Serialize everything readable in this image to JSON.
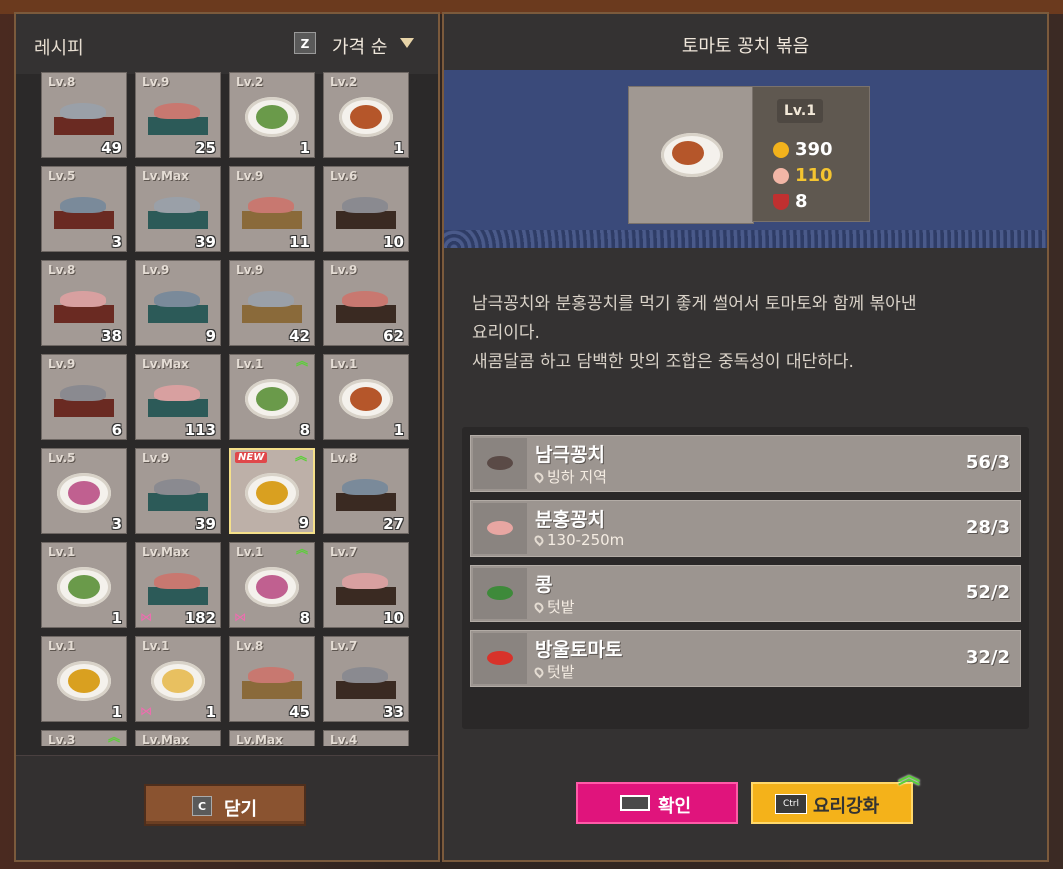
{
  "recipes_panel": {
    "title": "레시피",
    "sort_key": "Z",
    "sort_label": "가격 순",
    "close_key": "C",
    "close_label": "닫기",
    "cards": [
      {
        "lv": "Lv.8",
        "count": "49",
        "dish": "board"
      },
      {
        "lv": "Lv.9",
        "count": "25",
        "dish": "board"
      },
      {
        "lv": "Lv.2",
        "count": "1",
        "dish": "plate"
      },
      {
        "lv": "Lv.2",
        "count": "1",
        "dish": "plate"
      },
      {
        "lv": "Lv.5",
        "count": "3",
        "dish": "board"
      },
      {
        "lv": "Lv.Max",
        "count": "39",
        "dish": "board"
      },
      {
        "lv": "Lv.9",
        "count": "11",
        "dish": "board"
      },
      {
        "lv": "Lv.6",
        "count": "10",
        "dish": "board"
      },
      {
        "lv": "Lv.8",
        "count": "38",
        "dish": "board"
      },
      {
        "lv": "Lv.9",
        "count": "9",
        "dish": "board"
      },
      {
        "lv": "Lv.9",
        "count": "42",
        "dish": "board"
      },
      {
        "lv": "Lv.9",
        "count": "62",
        "dish": "board"
      },
      {
        "lv": "Lv.9",
        "count": "6",
        "dish": "board"
      },
      {
        "lv": "Lv.Max",
        "count": "113",
        "dish": "board"
      },
      {
        "lv": "Lv.1",
        "count": "8",
        "dish": "plate",
        "up": true
      },
      {
        "lv": "Lv.1",
        "count": "1",
        "dish": "plate"
      },
      {
        "lv": "Lv.5",
        "count": "3",
        "dish": "plate"
      },
      {
        "lv": "Lv.9",
        "count": "39",
        "dish": "board"
      },
      {
        "lv": "NEW",
        "count": "9",
        "dish": "plate",
        "up": true,
        "selected": true,
        "is_new": true
      },
      {
        "lv": "Lv.8",
        "count": "27",
        "dish": "board"
      },
      {
        "lv": "Lv.1",
        "count": "1",
        "dish": "plate"
      },
      {
        "lv": "Lv.Max",
        "count": "182",
        "dish": "board",
        "bow": true
      },
      {
        "lv": "Lv.1",
        "count": "8",
        "dish": "plate",
        "up": true,
        "bow": true
      },
      {
        "lv": "Lv.7",
        "count": "10",
        "dish": "board"
      },
      {
        "lv": "Lv.1",
        "count": "1",
        "dish": "plate"
      },
      {
        "lv": "Lv.1",
        "count": "1",
        "dish": "plate",
        "bow": true
      },
      {
        "lv": "Lv.8",
        "count": "45",
        "dish": "board"
      },
      {
        "lv": "Lv.7",
        "count": "33",
        "dish": "board"
      },
      {
        "lv": "Lv.3",
        "count": "",
        "dish": "none",
        "up": true
      },
      {
        "lv": "Lv.Max",
        "count": "",
        "dish": "none"
      },
      {
        "lv": "Lv.Max",
        "count": "",
        "dish": "none"
      },
      {
        "lv": "Lv.4",
        "count": "",
        "dish": "none"
      }
    ]
  },
  "detail_panel": {
    "title": "토마토 꽁치 볶음",
    "level": "Lv.1",
    "price": "390",
    "taste": "110",
    "servings": "8",
    "description": [
      "남극꽁치와 분홍꽁치를 먹기 좋게 썰어서 토마토와 함께 볶아낸",
      "요리이다.",
      "새콤달콤 하고 담백한 맛의 조합은 중독성이 대단하다."
    ],
    "ingredients": [
      {
        "name": "남극꽁치",
        "location": "빙하 지역",
        "qty": "56/3",
        "thumb_color": "#5a4a46"
      },
      {
        "name": "분홍꽁치",
        "location": "130-250m",
        "qty": "28/3",
        "thumb_color": "#e8a6a2"
      },
      {
        "name": "콩",
        "location": "텃밭",
        "qty": "52/2",
        "thumb_color": "#3e8a3a"
      },
      {
        "name": "방울토마토",
        "location": "텃밭",
        "qty": "32/2",
        "thumb_color": "#d8322a"
      }
    ],
    "confirm_label": "확인",
    "enhance_key": "Ctrl",
    "enhance_label": "요리강화"
  },
  "colors": {
    "confirm": "#e0147c",
    "enhance": "#f4b21a",
    "upgrade_arrow": "#5ccf3a",
    "banner": "#3a4a7a"
  }
}
